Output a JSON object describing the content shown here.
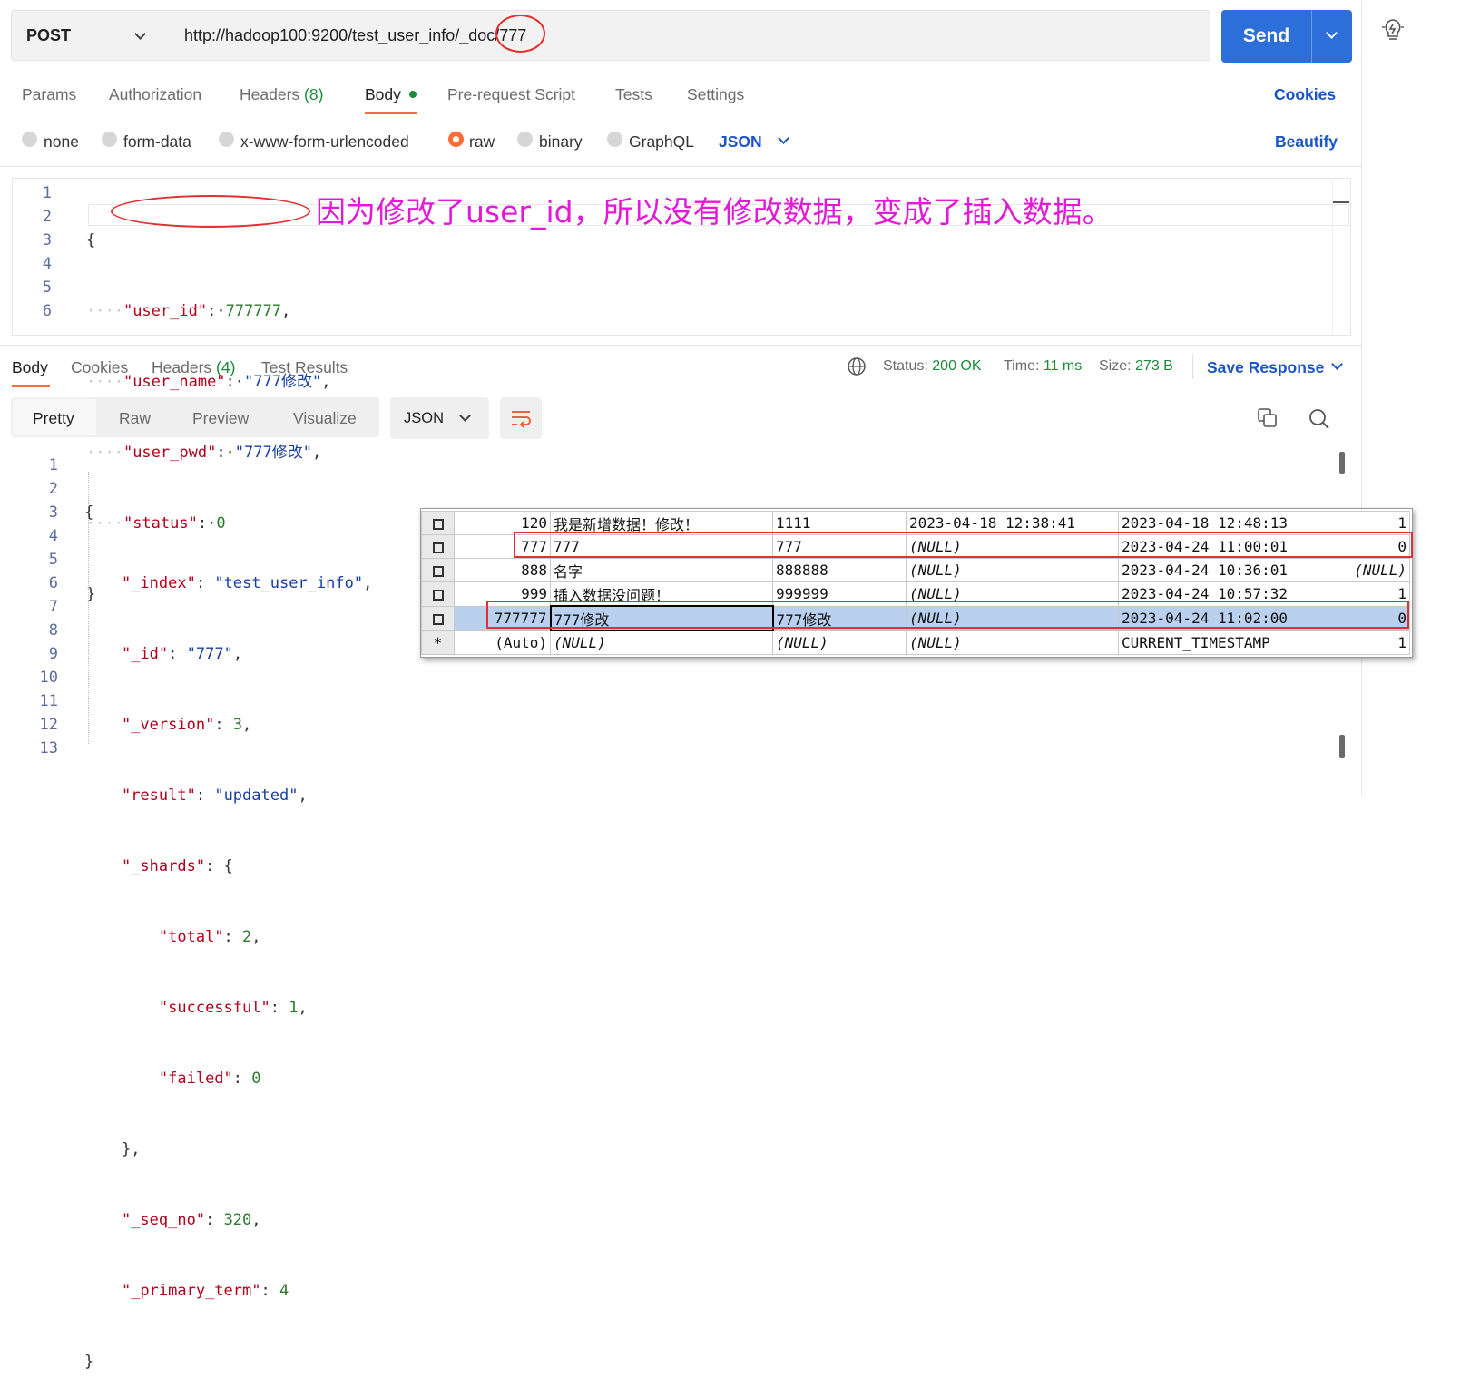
{
  "request": {
    "method": "POST",
    "url": "http://hadoop100:9200/test_user_info/_doc/777",
    "send_label": "Send"
  },
  "request_tabs": {
    "params": "Params",
    "authorization": "Authorization",
    "headers": "Headers",
    "headers_count": "(8)",
    "body": "Body",
    "prerequest": "Pre-request Script",
    "tests": "Tests",
    "settings": "Settings",
    "cookies": "Cookies"
  },
  "body_types": {
    "none": "none",
    "form_data": "form-data",
    "urlencoded": "x-www-form-urlencoded",
    "raw": "raw",
    "binary": "binary",
    "graphql": "GraphQL",
    "format": "JSON",
    "beautify": "Beautify",
    "selected": "raw"
  },
  "request_body": {
    "line_numbers": [
      "1",
      "2",
      "3",
      "4",
      "5",
      "6"
    ],
    "open": "{",
    "close": "}",
    "k1": "\"user_id\"",
    "v1": "777777",
    "k2": "\"user_name\"",
    "v2": "\"777修改\"",
    "k3": "\"user_pwd\"",
    "v3": "\"777修改\"",
    "k4": "\"status\"",
    "v4": "0"
  },
  "annotation": "因为修改了user_id，所以没有修改数据，变成了插入数据。",
  "response_tabs": {
    "body": "Body",
    "cookies": "Cookies",
    "headers": "Headers",
    "headers_count": "(4)",
    "test_results": "Test Results"
  },
  "response_status": {
    "status_label": "Status:",
    "status_value": "200 OK",
    "time_label": "Time:",
    "time_value": "11 ms",
    "size_label": "Size:",
    "size_value": "273 B",
    "save_response": "Save Response"
  },
  "response_view": {
    "pretty": "Pretty",
    "raw": "Raw",
    "preview": "Preview",
    "visualize": "Visualize",
    "format": "JSON"
  },
  "response_body": {
    "line_numbers": [
      "1",
      "2",
      "3",
      "4",
      "5",
      "6",
      "7",
      "8",
      "9",
      "10",
      "11",
      "12",
      "13"
    ],
    "open": "{",
    "close": "}",
    "k_index": "\"_index\"",
    "v_index": "\"test_user_info\"",
    "k_id": "\"_id\"",
    "v_id": "\"777\"",
    "k_version": "\"_version\"",
    "v_version": "3",
    "k_result": "\"result\"",
    "v_result": "\"updated\"",
    "k_shards": "\"_shards\"",
    "k_total": "\"total\"",
    "v_total": "2",
    "k_successful": "\"successful\"",
    "v_successful": "1",
    "k_failed": "\"failed\"",
    "v_failed": "0",
    "shards_close": "},",
    "k_seq": "\"_seq_no\"",
    "v_seq": "320",
    "k_primary": "\"_primary_term\"",
    "v_primary": "4"
  },
  "db_grid": {
    "rows": [
      {
        "marker": "box",
        "id": "120",
        "name": "我是新增数据！修改！",
        "pwd": "1111",
        "created": "2023-04-18 12:38:41",
        "updated": "2023-04-18 12:48:13",
        "status": "1"
      },
      {
        "marker": "box",
        "id": "777",
        "name": "777",
        "pwd": "777",
        "created": "(NULL)",
        "updated": "2023-04-24 11:00:01",
        "status": "0"
      },
      {
        "marker": "box",
        "id": "888",
        "name": "名字",
        "pwd": "888888",
        "created": "(NULL)",
        "updated": "2023-04-24 10:36:01",
        "status": "(NULL)"
      },
      {
        "marker": "box",
        "id": "999",
        "name": "插入数据没问题！",
        "pwd": "999999",
        "created": "(NULL)",
        "updated": "2023-04-24 10:57:32",
        "status": "1"
      },
      {
        "marker": "box",
        "id": "777777",
        "name": "777修改",
        "pwd": "777修改",
        "created": "(NULL)",
        "updated": "2023-04-24 11:02:00",
        "status": "0"
      },
      {
        "marker": "*",
        "id": "(Auto)",
        "name": "(NULL)",
        "pwd": "(NULL)",
        "created": "(NULL)",
        "updated": "CURRENT_TIMESTAMP",
        "status": "1"
      }
    ]
  },
  "icons": {
    "method_dropdown": "chevron-down-icon",
    "send_dropdown": "chevron-down-icon",
    "lightbulb": "lightbulb-icon",
    "globe": "globe-icon",
    "wrap": "wrap-lines-icon",
    "copy": "copy-icon",
    "search": "search-icon"
  },
  "colors": {
    "accent": "#ff6c37",
    "send": "#2c6fd8",
    "link": "#1a55c8",
    "status_ok": "#1c8a3a",
    "annotation": "#e21ad8",
    "highlight": "#e03030"
  }
}
